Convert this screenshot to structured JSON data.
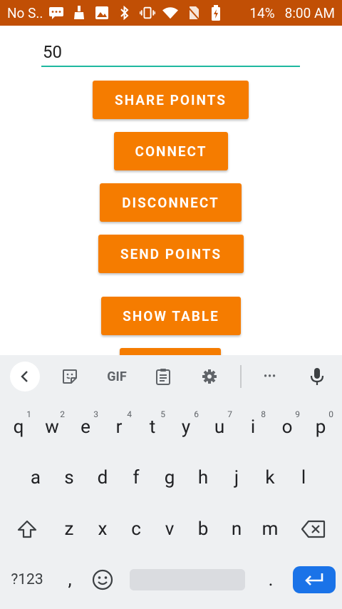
{
  "status_bar": {
    "carrier": "No S..",
    "battery": "14%",
    "time": "8:00 AM",
    "background_color": "#c14f05",
    "icons": [
      "message-icon",
      "cleaner-icon",
      "image-icon",
      "bluetooth-icon",
      "vibrate-icon",
      "wifi-icon",
      "no-sim-icon",
      "battery-charging-icon"
    ]
  },
  "form": {
    "input_value": "50",
    "accent_color": "#1fb8a0"
  },
  "buttons": {
    "share_points": "SHARE POINTS",
    "connect": "CONNECT",
    "disconnect": "DISCONNECT",
    "send_points": "SEND POINTS",
    "show_table": "SHOW TABLE",
    "color": "#f57c00"
  },
  "keyboard": {
    "toolbar": [
      "back-icon",
      "sticker-icon",
      "gif-icon",
      "clipboard-icon",
      "settings-icon",
      "more-icon",
      "microphone-icon"
    ],
    "gif_label": "GIF",
    "more_label": "•••",
    "row1": [
      {
        "key": "q",
        "hint": "1"
      },
      {
        "key": "w",
        "hint": "2"
      },
      {
        "key": "e",
        "hint": "3"
      },
      {
        "key": "r",
        "hint": "4"
      },
      {
        "key": "t",
        "hint": "5"
      },
      {
        "key": "y",
        "hint": "6"
      },
      {
        "key": "u",
        "hint": "7"
      },
      {
        "key": "i",
        "hint": "8"
      },
      {
        "key": "o",
        "hint": "9"
      },
      {
        "key": "p",
        "hint": "0"
      }
    ],
    "row2": [
      "a",
      "s",
      "d",
      "f",
      "g",
      "h",
      "j",
      "k",
      "l"
    ],
    "row3": [
      "z",
      "x",
      "c",
      "v",
      "b",
      "n",
      "m"
    ],
    "symbols_label": "?123",
    "comma": ",",
    "period": ".",
    "enter_color": "#1a73e8"
  }
}
